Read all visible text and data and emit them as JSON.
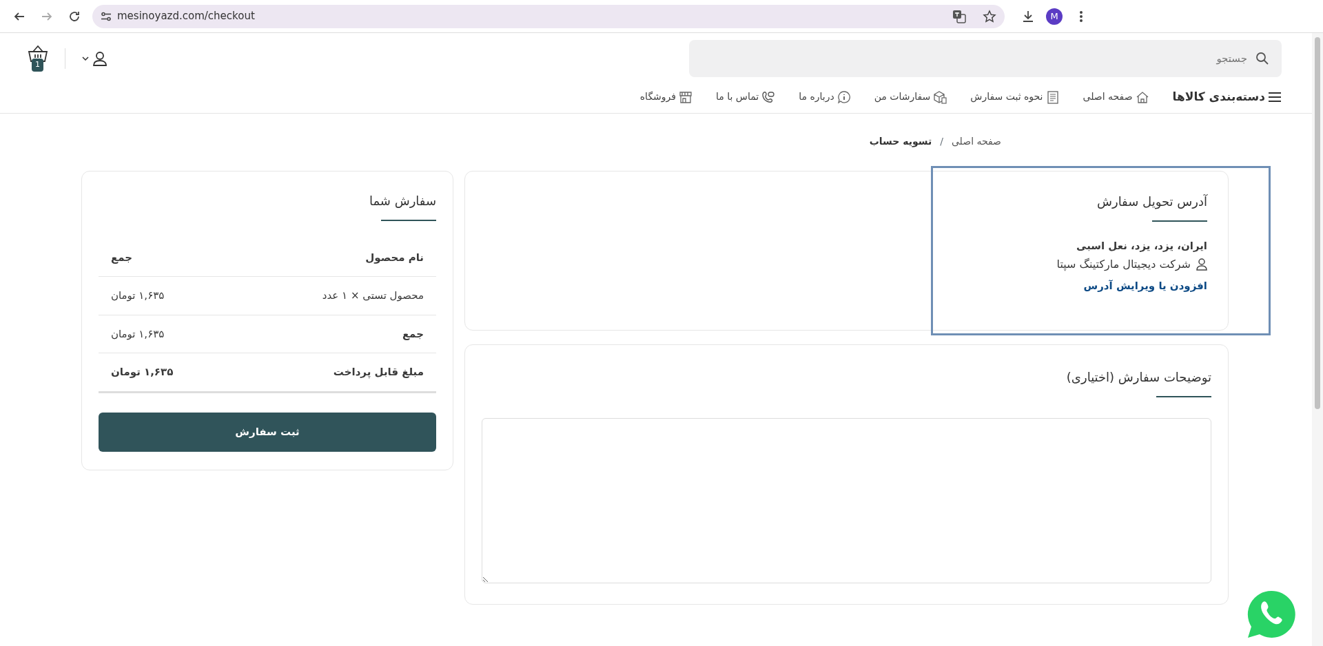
{
  "browser": {
    "url": "mesinoyazd.com/checkout",
    "profile_initial": "M"
  },
  "header": {
    "search": {
      "placeholder": "جستجو"
    },
    "cart_count": "1"
  },
  "nav": {
    "categories": "دسته‌بندی کالاها",
    "items": [
      {
        "label": "صفحه اصلی",
        "kind": "home"
      },
      {
        "label": "نحوه ثبت سفارش",
        "kind": "doc"
      },
      {
        "label": "سفارشات من",
        "kind": "box"
      },
      {
        "label": "درباره ما",
        "kind": "info"
      },
      {
        "label": "تماس با ما",
        "kind": "phone"
      },
      {
        "label": "فروشگاه",
        "kind": "shop"
      }
    ]
  },
  "breadcrumb_separator": "/",
  "breadcrumb": [
    {
      "label": "صفحه اصلی",
      "current": false
    },
    {
      "label": "تسویه حساب",
      "current": true
    }
  ],
  "order": {
    "title": "سفارش شما",
    "columns": [
      "نام محصول",
      "جمع"
    ],
    "rows": [
      {
        "kind": "item",
        "label": "محصول تستی × ۱ عدد",
        "value": "۱,۶۳۵ تومان"
      },
      {
        "kind": "subtotal",
        "label": "جمع",
        "value": "۱,۶۳۵ تومان"
      },
      {
        "kind": "total",
        "label": "مبلغ قابل پرداخت",
        "value": "۱,۶۳۵ تومان"
      }
    ],
    "button": "ثبت سفارش"
  },
  "address": {
    "title": "آدرس تحویل سفارش",
    "line": "ایران، یزد، یزد، نعل اسبی",
    "recipient": "شرکت دیجیتال مارکتینگ سپتا",
    "link": "افزودن یا ویرایش آدرس"
  },
  "notes": {
    "title": "توضیحات سفارش (اختیاری)"
  }
}
